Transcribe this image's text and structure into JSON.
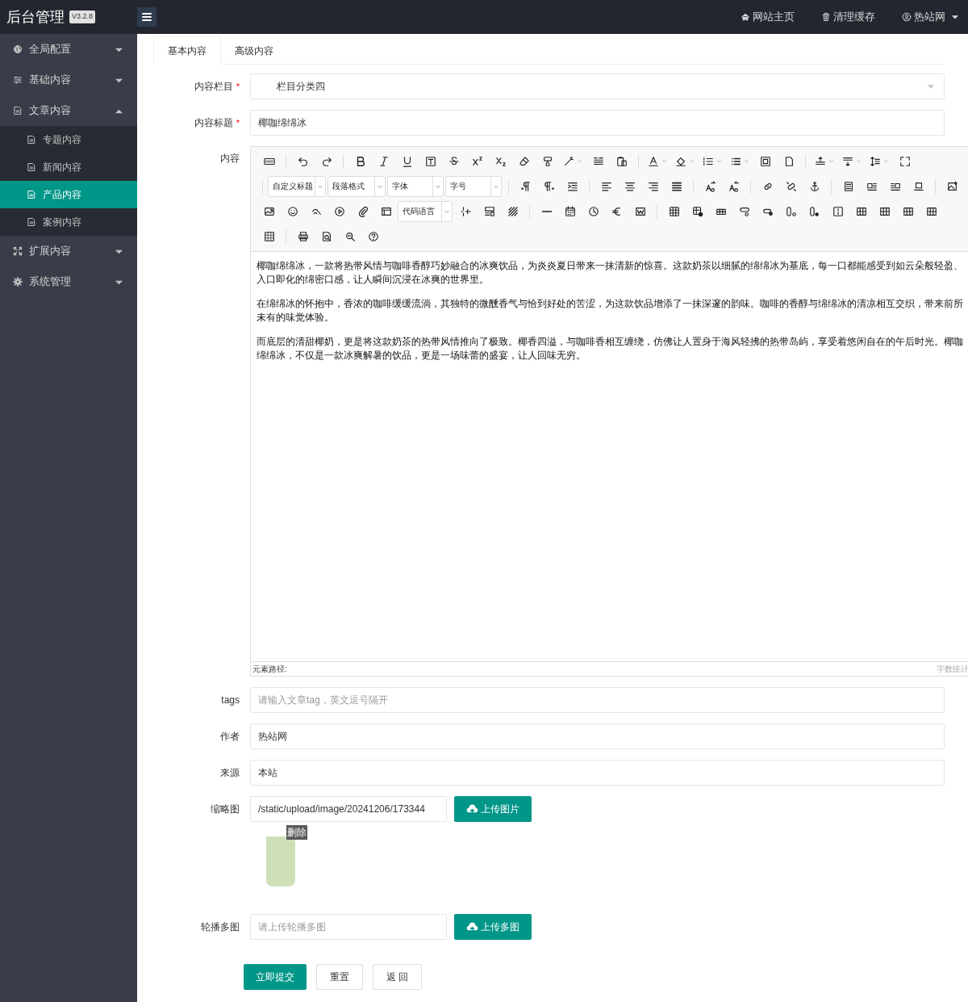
{
  "header": {
    "brand": "后台管理",
    "version": "V3.2.8",
    "links": [
      {
        "kind": "home",
        "label": "网站主页"
      },
      {
        "kind": "trash",
        "label": "清理缓存"
      },
      {
        "kind": "user",
        "label": "热站网"
      }
    ]
  },
  "sidebar": {
    "items": [
      {
        "label": "全局配置",
        "expanded": false,
        "selected": false
      },
      {
        "label": "基础内容",
        "expanded": false,
        "selected": false
      },
      {
        "label": "文章内容",
        "expanded": true,
        "selected": false,
        "children": [
          {
            "label": "专题内容",
            "selected": false
          },
          {
            "label": "新闻内容",
            "selected": false
          },
          {
            "label": "产品内容",
            "selected": true
          },
          {
            "label": "案例内容",
            "selected": false
          }
        ]
      },
      {
        "label": "扩展内容",
        "expanded": false,
        "selected": false
      },
      {
        "label": "系统管理",
        "expanded": false,
        "selected": false
      }
    ]
  },
  "tabs": [
    {
      "label": "基本内容",
      "selected": true
    },
    {
      "label": "高级内容",
      "selected": false
    }
  ],
  "form": {
    "category": {
      "label": "内容栏目",
      "required_mark": "*",
      "value": "栏目分类四"
    },
    "title": {
      "label": "内容标题",
      "required_mark": "*",
      "value": "椰咖绵绵冰"
    },
    "content": {
      "label": "内容",
      "dropdowns": [
        "自定义标题",
        "段落格式",
        "字体",
        "字号",
        "代码语言"
      ],
      "paragraphs": [
        "椰咖绵绵冰，一款将热带风情与咖啡香醇巧妙融合的冰爽饮品，为炎炎夏日带来一抹清新的惊喜。这款奶茶以细腻的绵绵冰为基底，每一口都能感受到如云朵般轻盈、入口即化的绵密口感，让人瞬间沉浸在冰爽的世界里。",
        "在绵绵冰的怀抱中，香浓的咖啡缓缓流淌，其独特的微醺香气与恰到好处的苦涩，为这款饮品增添了一抹深邃的韵味。咖啡的香醇与绵绵冰的清凉相互交织，带来前所未有的味觉体验。",
        "而底层的清甜椰奶，更是将这款奶茶的热带风情推向了极致。椰香四溢，与咖啡香相互缠绕，仿佛让人置身于海风轻拂的热带岛屿，享受着悠闲自在的午后时光。椰咖绵绵冰，不仅是一款冰爽解暑的饮品，更是一场味蕾的盛宴，让人回味无穷。"
      ],
      "path_label": "元素路径:",
      "count_label": "字数统计"
    },
    "tags": {
      "label": "tags",
      "placeholder": "请输入文章tag，英文逗号隔开"
    },
    "author": {
      "label": "作者",
      "value": "热站网"
    },
    "source": {
      "label": "来源",
      "value": "本站"
    },
    "thumbnail": {
      "label": "缩略图",
      "value": "/static/upload/image/20241206/173344",
      "button": "上传图片",
      "delete": "删除"
    },
    "gallery": {
      "label": "轮播多图",
      "placeholder": "请上传轮播多图",
      "button": "上传多图"
    }
  },
  "actions": [
    {
      "kind": "primary",
      "label": "立即提交"
    },
    {
      "kind": "plain",
      "label": "重置"
    },
    {
      "kind": "plain",
      "label": "返 回"
    }
  ]
}
